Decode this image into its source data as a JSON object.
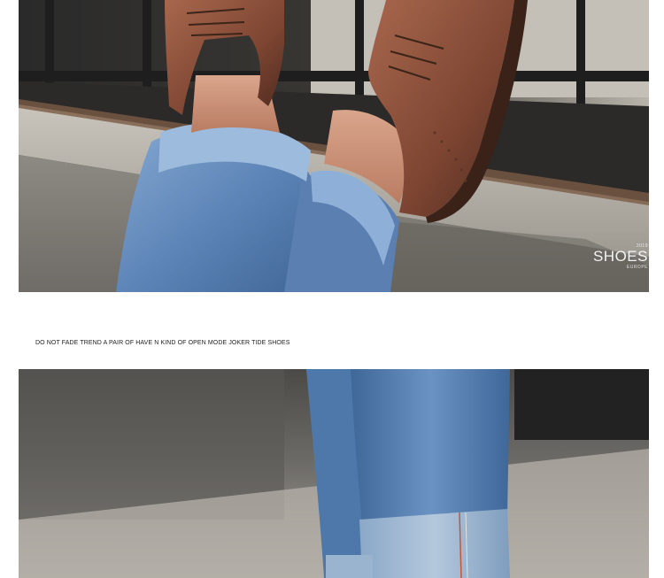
{
  "top_photo": {
    "watermark_main": "SHOES",
    "watermark_small_top": "2019",
    "watermark_small_bottom": "EUROPE"
  },
  "caption": "DO NOT FADE TREND A PAIR OF HAVE N KIND OF OPEN MODE JOKER TIDE SHOES",
  "colors": {
    "leather": "#8a4f3a",
    "denim": "#5e86b8",
    "concrete": "#b9b5ad",
    "rail": "#1e1e1e"
  }
}
